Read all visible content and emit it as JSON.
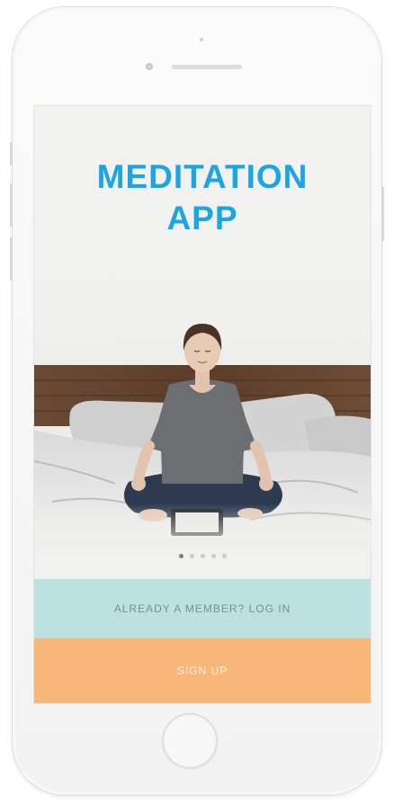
{
  "app": {
    "title_line1": "MEDITATION",
    "title_line2": "APP"
  },
  "carousel": {
    "page_count": 5,
    "active_index": 0
  },
  "actions": {
    "login_label": "ALREADY A MEMBER? LOG IN",
    "signup_label": "SIGN UP"
  },
  "colors": {
    "title": "#1ba6e1",
    "login_bg": "#bde0e0",
    "signup_bg": "#f7b779"
  }
}
